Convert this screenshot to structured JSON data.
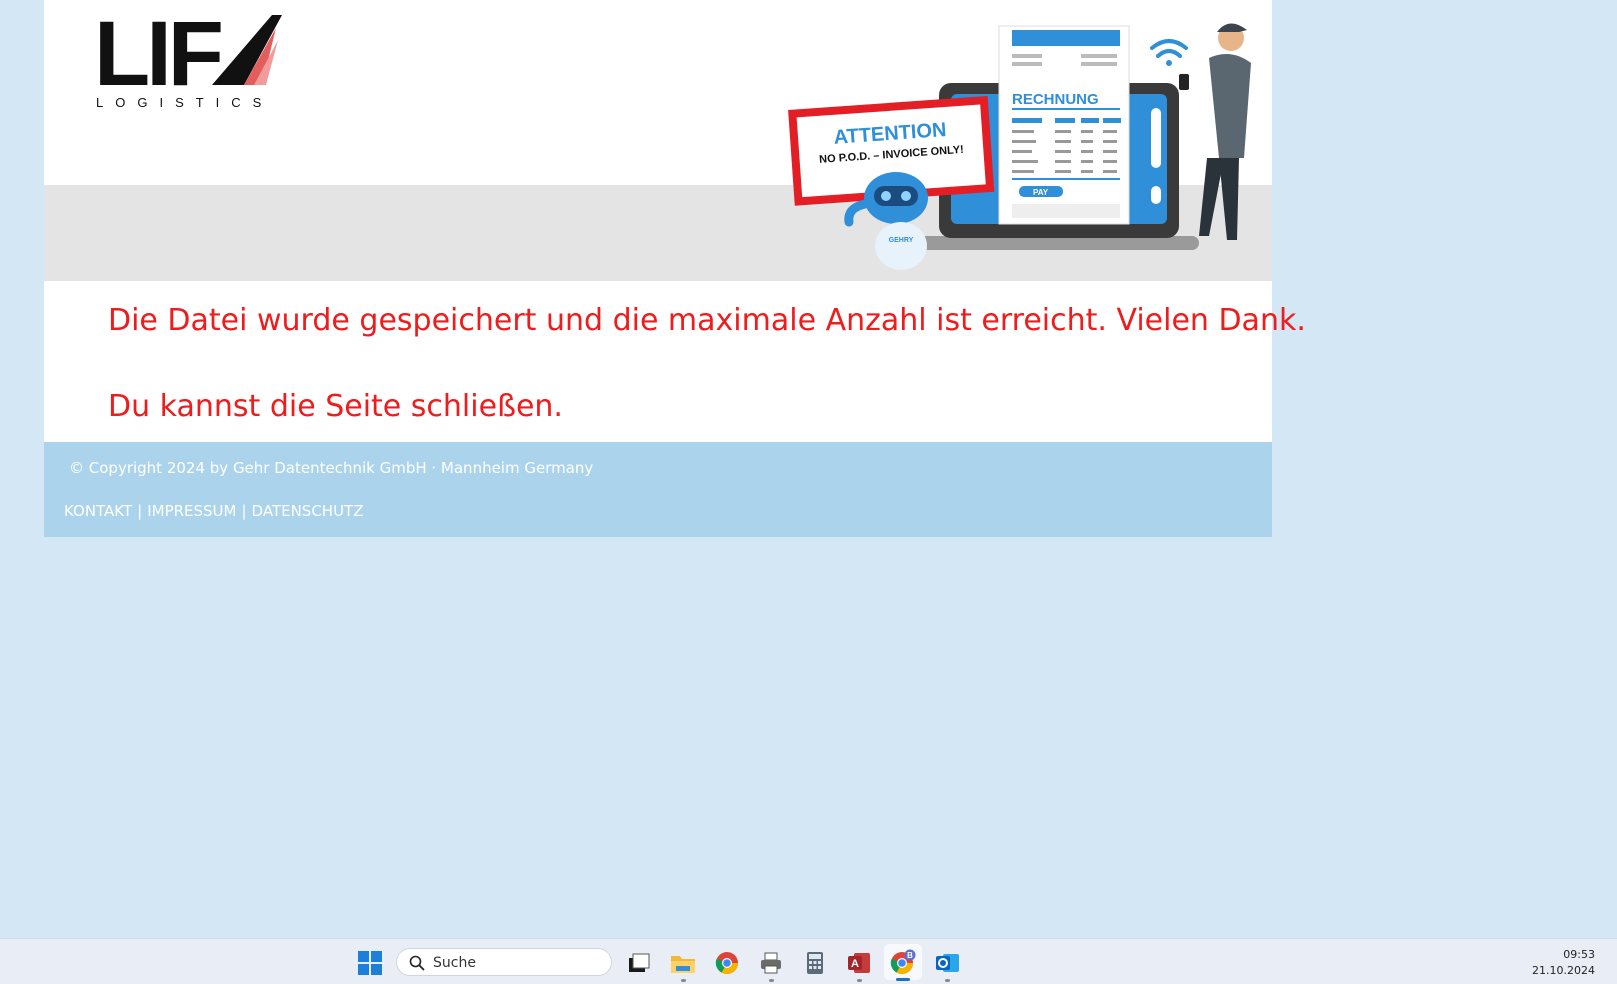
{
  "brand": {
    "logo_text": "LIF",
    "logo_sub": "LOGISTICS"
  },
  "banner": {
    "attention_title": "ATTENTION",
    "attention_sub": "NO P.O.D. – INVOICE ONLY!",
    "invoice_title": "RECHNUNG",
    "pay_label": "PAY",
    "robot_label": "GEHRY"
  },
  "message": {
    "line1": "Die Datei wurde gespeichert und die maximale Anzahl ist erreicht. Vielen Dank.",
    "line2": "Du kannst die Seite schließen."
  },
  "footer": {
    "copyright": "© Copyright 2024 by Gehr Datentechnik GmbH · Mannheim Germany",
    "links": [
      "KONTAKT",
      "IMPRESSUM",
      "DATENSCHUTZ"
    ],
    "separator": "|"
  },
  "taskbar": {
    "search_placeholder": "Suche",
    "chrome_badge": "B",
    "time": "09:53",
    "date": "21.10.2024",
    "icons": [
      "windows-start-icon",
      "task-view-icon",
      "file-explorer-icon",
      "chrome-icon",
      "printer-icon",
      "calculator-icon",
      "access-icon",
      "chrome-profile-icon",
      "outlook-icon"
    ]
  },
  "colors": {
    "background": "#d3e7f4",
    "message_red": "#ee1c1c",
    "footer_blue": "#abd4ec",
    "header_gray": "#e4e4e4"
  }
}
